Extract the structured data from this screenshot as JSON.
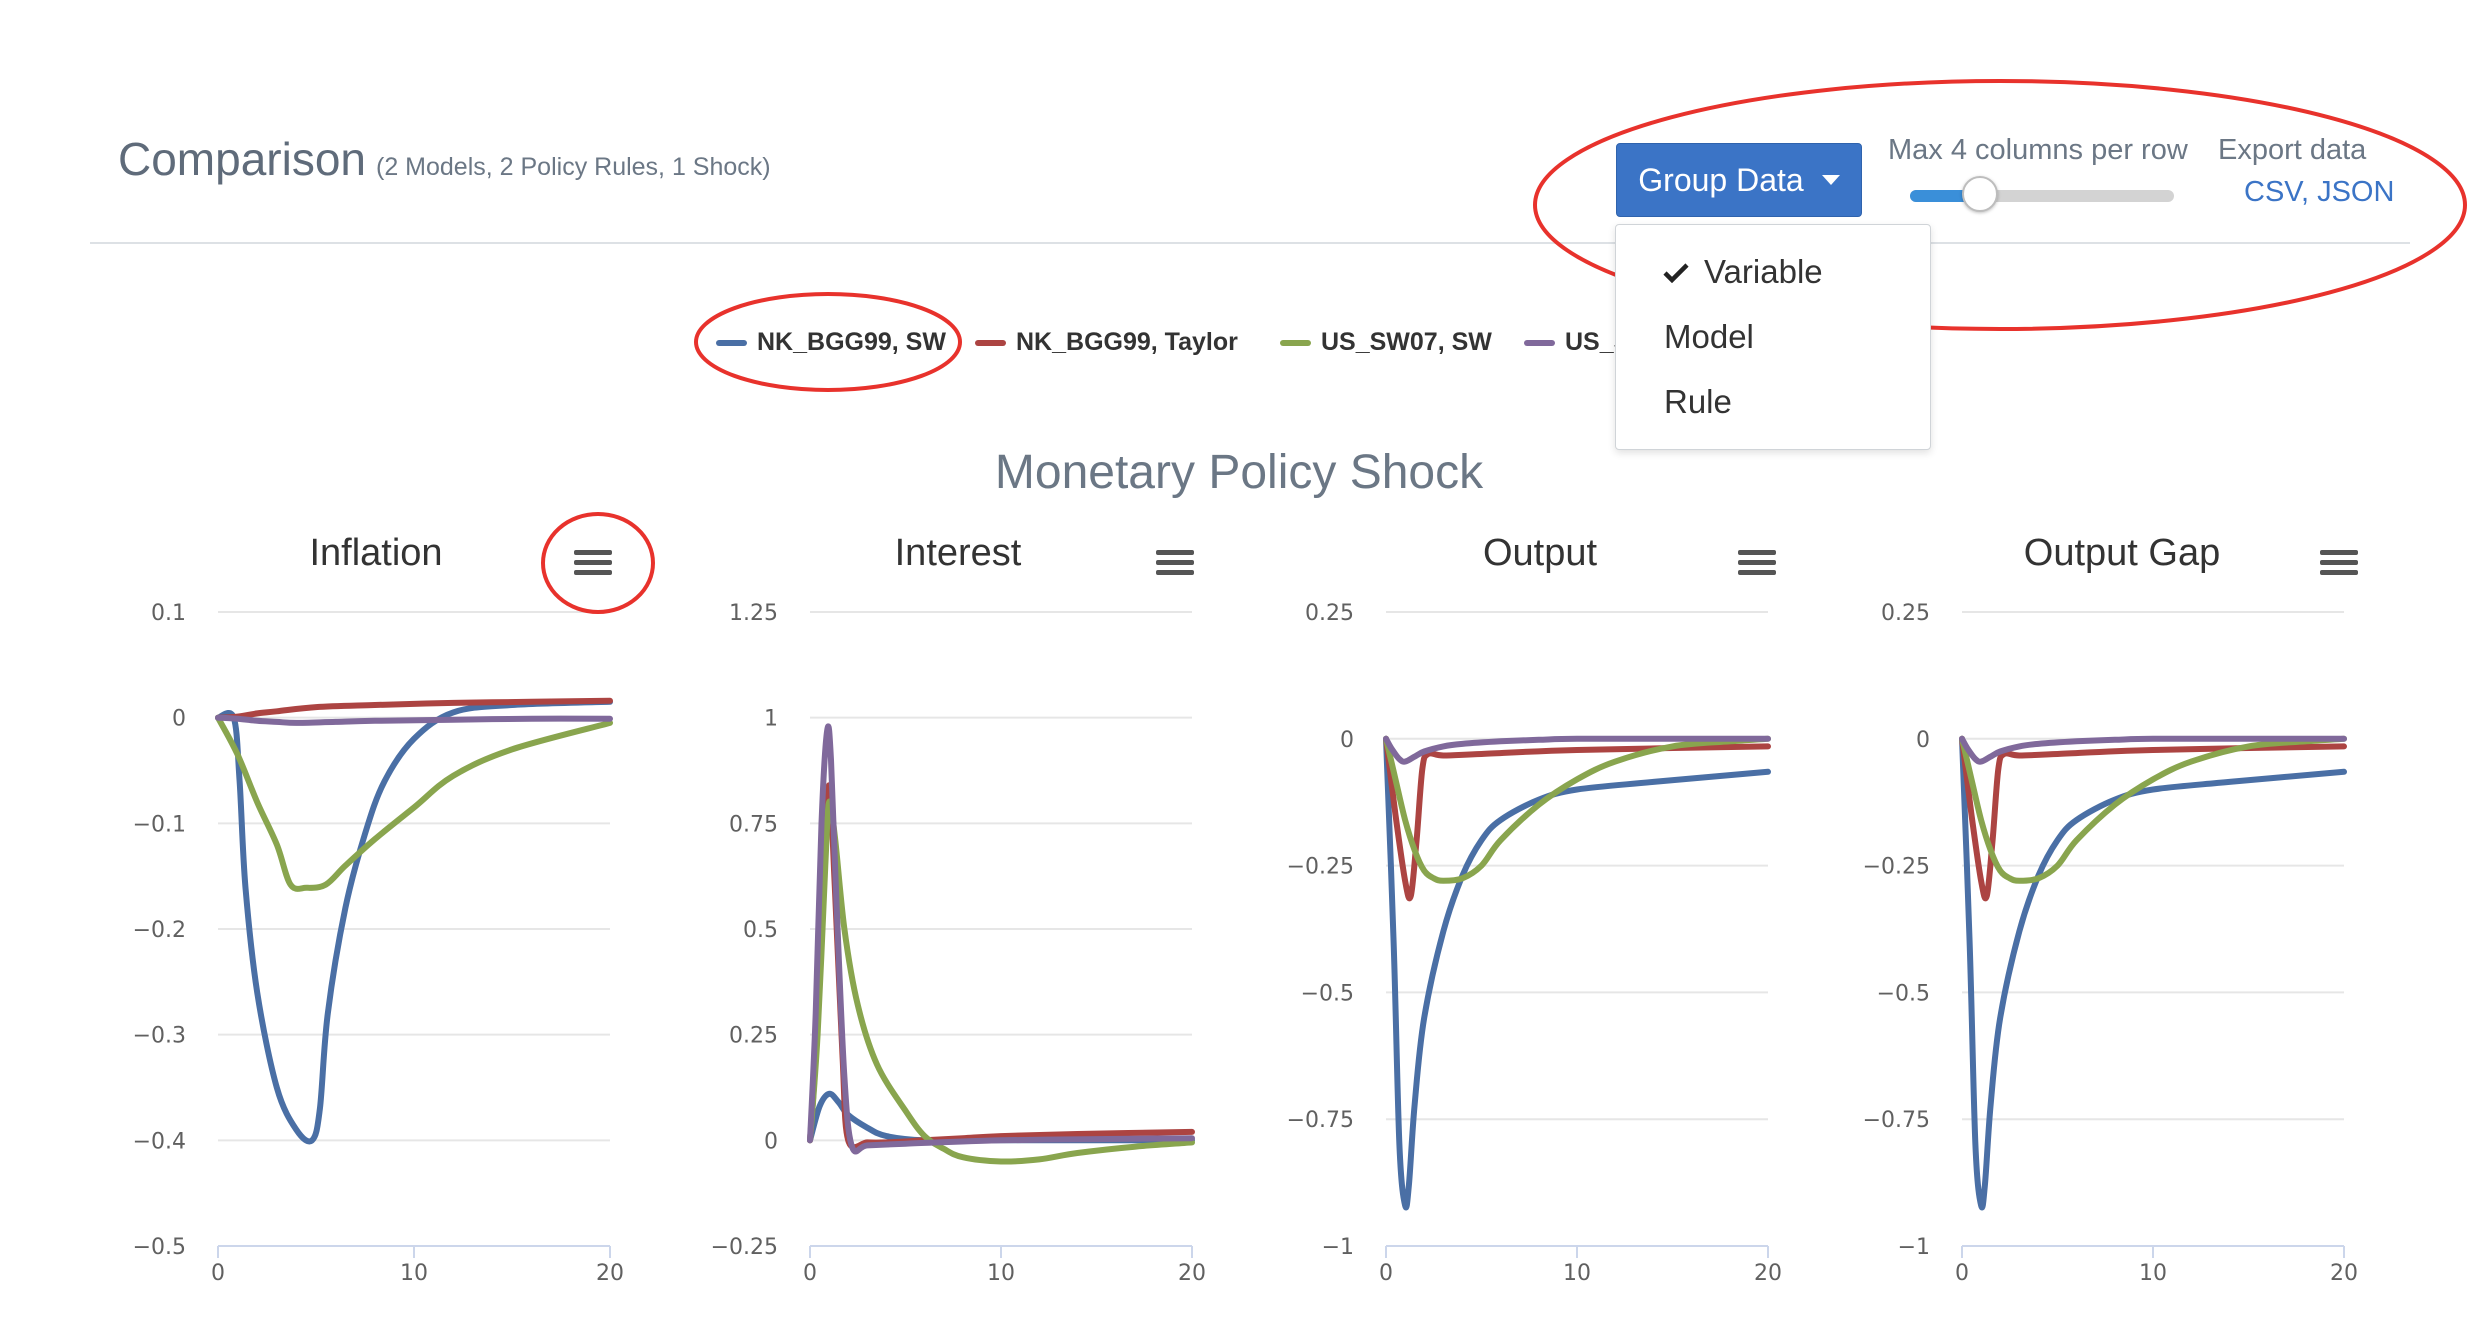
{
  "header": {
    "title": "Comparison",
    "subtitle": "(2 Models, 2 Policy Rules, 1 Shock)"
  },
  "controls": {
    "group_button": "Group Data",
    "columns_label": "Max 4 columns per row",
    "columns_value": 4,
    "export_label": "Export data",
    "export_links": "CSV, JSON"
  },
  "group_menu": {
    "items": [
      "Variable",
      "Model",
      "Rule"
    ],
    "selected": "Variable"
  },
  "legend": [
    {
      "label": "NK_BGG99, SW",
      "color": "#4a6fa5"
    },
    {
      "label": "NK_BGG99, Taylor",
      "color": "#ac4442"
    },
    {
      "label": "US_SW07, SW",
      "color": "#89a54e"
    },
    {
      "label": "US_S",
      "color": "#80699b"
    }
  ],
  "section_title": "Monetary Policy Shock",
  "chart_data": [
    {
      "type": "line",
      "title": "Inflation",
      "xlabel": "",
      "ylabel": "",
      "xlim": [
        0,
        20
      ],
      "ylim": [
        -0.5,
        0.1
      ],
      "yticks": [
        0.1,
        0,
        -0.1,
        -0.2,
        -0.3,
        -0.4,
        -0.5
      ],
      "yticklabels": [
        "0.1",
        "0",
        "−0.1",
        "−0.2",
        "−0.3",
        "−0.4",
        "−0.5"
      ],
      "xticks": [
        0,
        10,
        20
      ],
      "grid": true,
      "series": [
        {
          "color": "#4a6fa5",
          "x": [
            0,
            0.8,
            1.1,
            1.4,
            2,
            3,
            4,
            4.8,
            5.2,
            5.6,
            6.5,
            7.5,
            8.5,
            10,
            12,
            15,
            20
          ],
          "y": [
            0,
            0,
            -0.06,
            -0.16,
            -0.26,
            -0.35,
            -0.39,
            -0.4,
            -0.37,
            -0.28,
            -0.18,
            -0.11,
            -0.06,
            -0.02,
            0.005,
            0.012,
            0.015
          ]
        },
        {
          "color": "#ac4442",
          "x": [
            0,
            1,
            2,
            3,
            5,
            8,
            12,
            16,
            20
          ],
          "y": [
            0,
            0.001,
            0.004,
            0.006,
            0.01,
            0.012,
            0.014,
            0.015,
            0.016
          ]
        },
        {
          "color": "#89a54e",
          "x": [
            0,
            1,
            2,
            3,
            3.7,
            4.5,
            5.5,
            6.5,
            8,
            10,
            12,
            15,
            20
          ],
          "y": [
            0,
            -0.035,
            -0.08,
            -0.12,
            -0.158,
            -0.161,
            -0.158,
            -0.14,
            -0.115,
            -0.085,
            -0.055,
            -0.03,
            -0.005
          ]
        },
        {
          "color": "#80699b",
          "x": [
            0,
            1,
            2,
            3,
            4,
            6,
            8,
            12,
            16,
            20
          ],
          "y": [
            0,
            -0.001,
            -0.003,
            -0.004,
            -0.005,
            -0.004,
            -0.003,
            -0.002,
            -0.001,
            -0.001
          ]
        }
      ]
    },
    {
      "type": "line",
      "title": "Interest",
      "xlabel": "",
      "ylabel": "",
      "xlim": [
        0,
        20
      ],
      "ylim": [
        -0.25,
        1.25
      ],
      "yticks": [
        1.25,
        1,
        0.75,
        0.5,
        0.25,
        0,
        -0.25
      ],
      "yticklabels": [
        "1.25",
        "1",
        "0.75",
        "0.5",
        "0.25",
        "0",
        "−0.25"
      ],
      "xticks": [
        0,
        10,
        20
      ],
      "grid": true,
      "series": [
        {
          "color": "#4a6fa5",
          "x": [
            0,
            0.5,
            1,
            1.5,
            2,
            3,
            4,
            6,
            10,
            15,
            20
          ],
          "y": [
            0,
            0.08,
            0.11,
            0.09,
            0.06,
            0.03,
            0.01,
            0,
            0,
            0,
            0
          ]
        },
        {
          "color": "#ac4442",
          "x": [
            0,
            0.3,
            0.7,
            1,
            1.3,
            1.7,
            2,
            3,
            4,
            6,
            8,
            10,
            14,
            20
          ],
          "y": [
            0,
            0.2,
            0.6,
            0.84,
            0.6,
            0.2,
            0,
            -0.005,
            -0.005,
            0,
            0.005,
            0.01,
            0.015,
            0.02
          ]
        },
        {
          "color": "#89a54e",
          "x": [
            0,
            0.4,
            0.8,
            1,
            1.3,
            1.8,
            2.5,
            3.5,
            5,
            6,
            7,
            8,
            10,
            12,
            14,
            17,
            20
          ],
          "y": [
            0,
            0.25,
            0.65,
            0.8,
            0.72,
            0.5,
            0.32,
            0.18,
            0.07,
            0.01,
            -0.02,
            -0.04,
            -0.05,
            -0.045,
            -0.03,
            -0.015,
            -0.005
          ]
        },
        {
          "color": "#80699b",
          "x": [
            0,
            0.3,
            0.6,
            0.9,
            1.1,
            1.4,
            1.8,
            2.2,
            3,
            5,
            10,
            15,
            20
          ],
          "y": [
            0,
            0.3,
            0.75,
            0.97,
            0.9,
            0.55,
            0.15,
            -0.015,
            -0.012,
            -0.008,
            0,
            0.003,
            0.005
          ]
        }
      ]
    },
    {
      "type": "line",
      "title": "Output",
      "xlabel": "",
      "ylabel": "",
      "xlim": [
        0,
        20
      ],
      "ylim": [
        -1,
        0.25
      ],
      "yticks": [
        0.25,
        0,
        -0.25,
        -0.5,
        -0.75,
        -1
      ],
      "yticklabels": [
        "0.25",
        "0",
        "−0.25",
        "−0.5",
        "−0.75",
        "−1"
      ],
      "xticks": [
        0,
        10,
        20
      ],
      "grid": true,
      "series": [
        {
          "color": "#4a6fa5",
          "x": [
            0,
            0.4,
            0.7,
            1,
            1.2,
            1.5,
            2,
            3,
            4,
            5,
            6,
            8,
            10,
            14,
            20
          ],
          "y": [
            0,
            -0.4,
            -0.8,
            -0.92,
            -0.88,
            -0.72,
            -0.55,
            -0.38,
            -0.27,
            -0.2,
            -0.16,
            -0.12,
            -0.1,
            -0.085,
            -0.065
          ]
        },
        {
          "color": "#ac4442",
          "x": [
            0,
            0.5,
            1,
            1.3,
            1.6,
            1.9,
            2.2,
            3,
            5,
            10,
            20
          ],
          "y": [
            0,
            -0.15,
            -0.28,
            -0.31,
            -0.2,
            -0.06,
            -0.03,
            -0.033,
            -0.03,
            -0.022,
            -0.015
          ]
        },
        {
          "color": "#89a54e",
          "x": [
            0,
            0.5,
            1,
            1.5,
            2,
            2.5,
            3,
            4,
            5,
            6,
            8,
            10,
            12,
            15,
            18,
            20
          ],
          "y": [
            0,
            -0.08,
            -0.16,
            -0.22,
            -0.26,
            -0.275,
            -0.28,
            -0.275,
            -0.25,
            -0.2,
            -0.13,
            -0.08,
            -0.045,
            -0.015,
            -0.005,
            0
          ]
        },
        {
          "color": "#80699b",
          "x": [
            0,
            0.3,
            0.7,
            1,
            1.5,
            2,
            3,
            4,
            6,
            8,
            10,
            15,
            20
          ],
          "y": [
            0,
            -0.02,
            -0.04,
            -0.045,
            -0.035,
            -0.025,
            -0.015,
            -0.01,
            -0.005,
            -0.002,
            0,
            0,
            0
          ]
        }
      ]
    },
    {
      "type": "line",
      "title": "Output Gap",
      "xlabel": "",
      "ylabel": "",
      "xlim": [
        0,
        20
      ],
      "ylim": [
        -1,
        0.25
      ],
      "yticks": [
        0.25,
        0,
        -0.25,
        -0.5,
        -0.75,
        -1
      ],
      "yticklabels": [
        "0.25",
        "0",
        "−0.25",
        "−0.5",
        "−0.75",
        "−1"
      ],
      "xticks": [
        0,
        10,
        20
      ],
      "grid": true,
      "series": [
        {
          "color": "#4a6fa5",
          "x": [
            0,
            0.4,
            0.7,
            1,
            1.2,
            1.5,
            2,
            3,
            4,
            5,
            6,
            8,
            10,
            14,
            20
          ],
          "y": [
            0,
            -0.4,
            -0.8,
            -0.92,
            -0.88,
            -0.72,
            -0.55,
            -0.38,
            -0.27,
            -0.2,
            -0.16,
            -0.12,
            -0.1,
            -0.085,
            -0.065
          ]
        },
        {
          "color": "#ac4442",
          "x": [
            0,
            0.5,
            1,
            1.3,
            1.6,
            1.9,
            2.2,
            3,
            5,
            10,
            20
          ],
          "y": [
            0,
            -0.15,
            -0.28,
            -0.31,
            -0.2,
            -0.06,
            -0.03,
            -0.033,
            -0.03,
            -0.022,
            -0.015
          ]
        },
        {
          "color": "#89a54e",
          "x": [
            0,
            0.5,
            1,
            1.5,
            2,
            2.5,
            3,
            4,
            5,
            6,
            8,
            10,
            12,
            15,
            18,
            20
          ],
          "y": [
            0,
            -0.08,
            -0.16,
            -0.22,
            -0.26,
            -0.275,
            -0.28,
            -0.275,
            -0.25,
            -0.2,
            -0.13,
            -0.08,
            -0.045,
            -0.015,
            -0.005,
            0
          ]
        },
        {
          "color": "#80699b",
          "x": [
            0,
            0.3,
            0.7,
            1,
            1.5,
            2,
            3,
            4,
            6,
            8,
            10,
            15,
            20
          ],
          "y": [
            0,
            -0.02,
            -0.04,
            -0.045,
            -0.035,
            -0.025,
            -0.015,
            -0.01,
            -0.005,
            -0.002,
            0,
            0,
            0
          ]
        }
      ]
    }
  ]
}
